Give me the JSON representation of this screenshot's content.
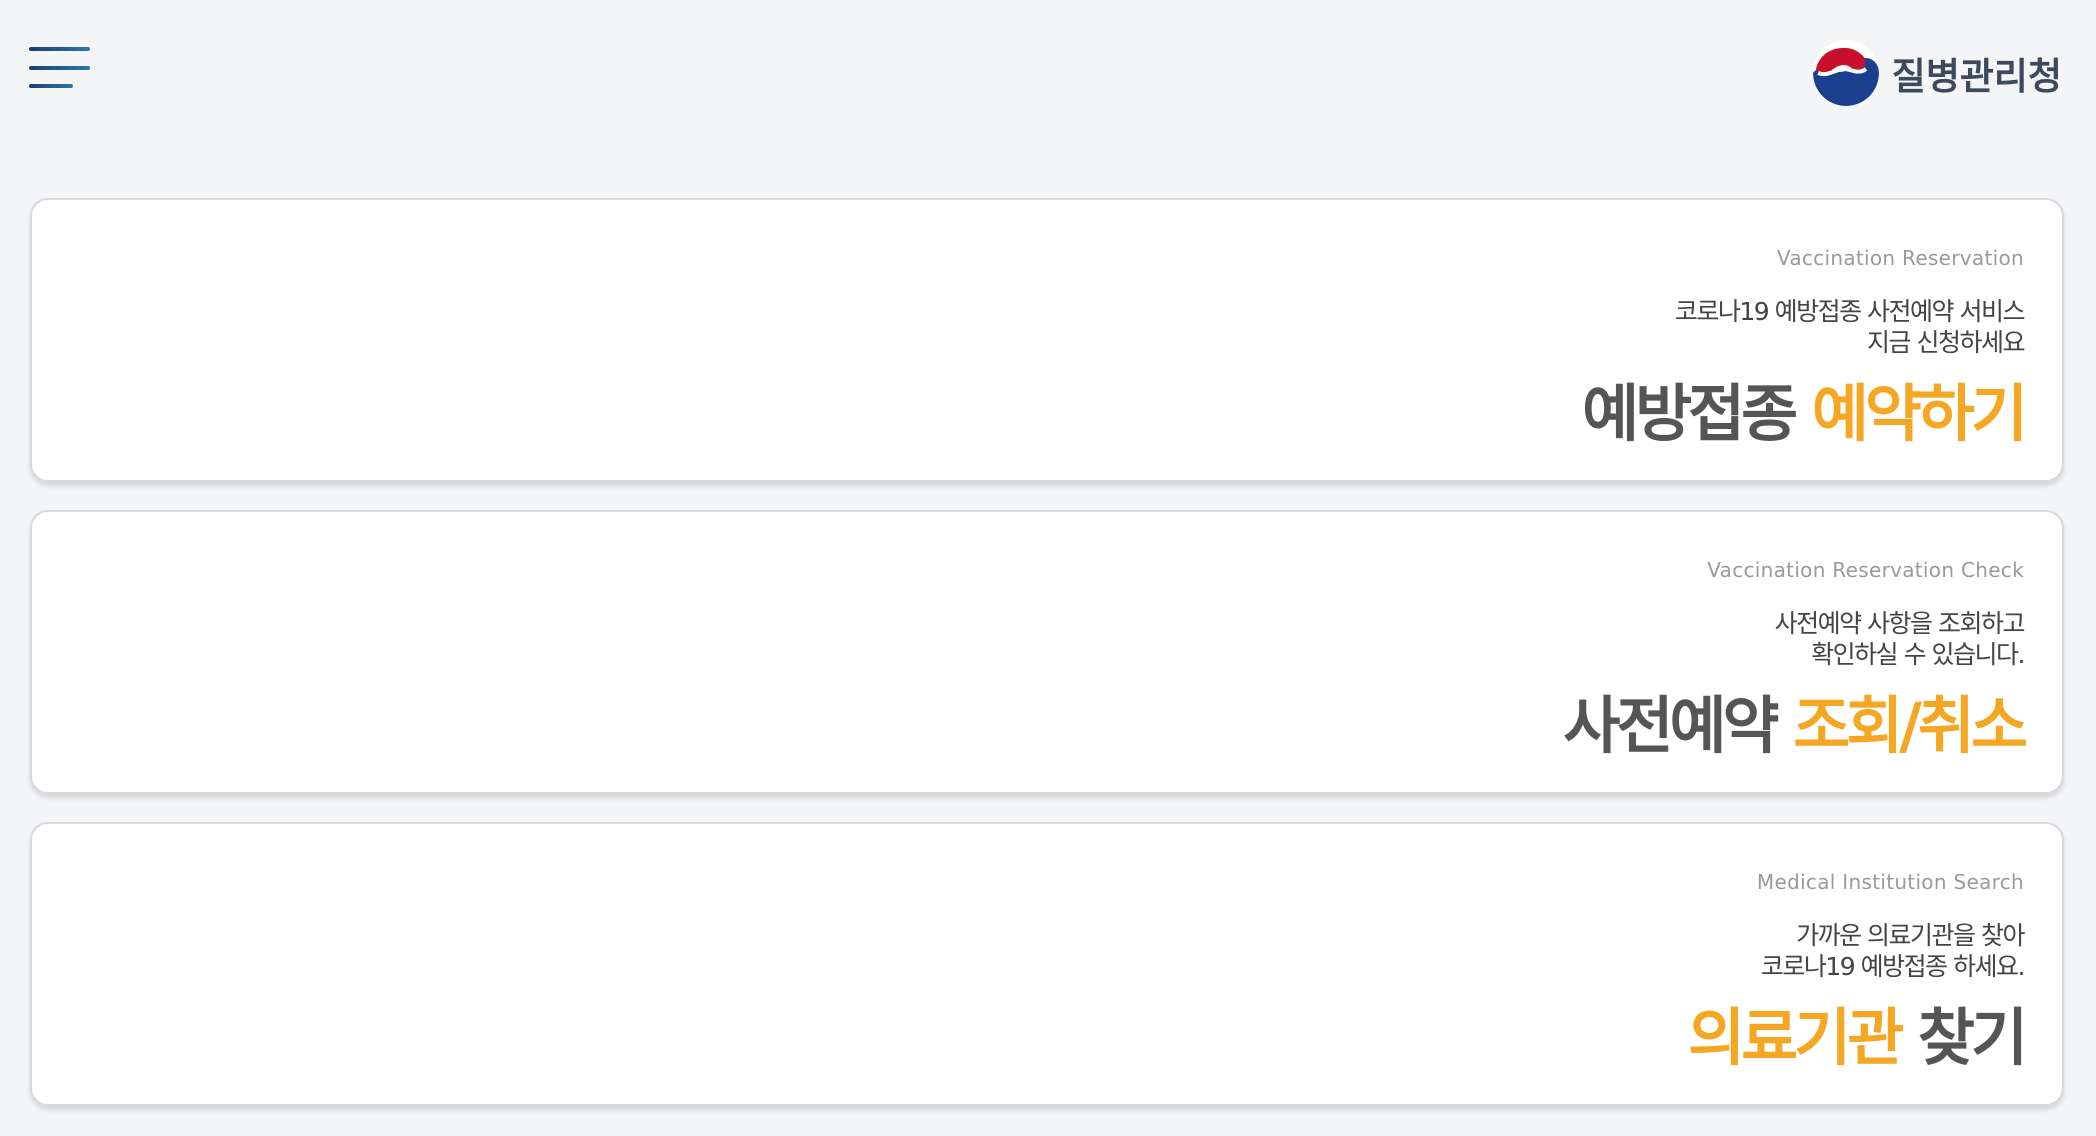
{
  "header": {
    "menu_icon": "hamburger-menu-icon",
    "agency_name": "질병관리청",
    "emblem_icon": "taegeuk-emblem-icon",
    "colors": {
      "menu": "#1b3f73",
      "emblem_red": "#c8102e",
      "emblem_blue": "#1a3f8f"
    }
  },
  "cards": [
    {
      "eng": "Vaccination Reservation",
      "desc_line1": "코로나19 예방접종 사전예약 서비스",
      "desc_line2": "지금 신청하세요",
      "title_part1": "예방접종",
      "title_part2": "예약하기"
    },
    {
      "eng": "Vaccination Reservation Check",
      "desc_line1": "사전예약 사항을 조회하고",
      "desc_line2": "확인하실 수 있습니다.",
      "title_part1": "사전예약",
      "title_part2": "조회/취소"
    },
    {
      "eng": "Medical Institution Search",
      "desc_line1": "가까운 의료기관을 찾아",
      "desc_line2": "코로나19 예방접종 하세요.",
      "title_part1": "의료기관",
      "title_part2": "찾기"
    }
  ],
  "colors": {
    "accent": "#f5a623",
    "title_gray": "#555555",
    "background": "#f4f5f7"
  }
}
